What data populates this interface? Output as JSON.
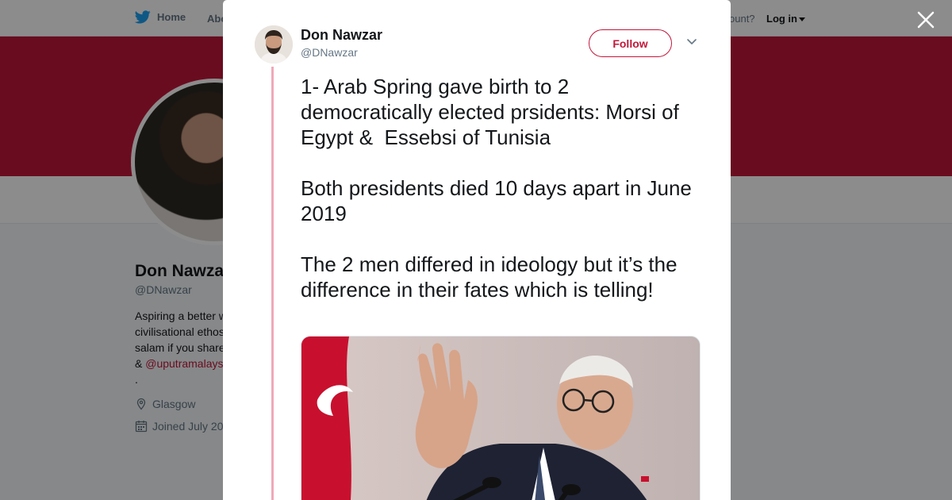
{
  "nav": {
    "home_label": "Home",
    "about_label": "Abo",
    "account_prompt": "ccount?",
    "login_label": "Log in"
  },
  "profile": {
    "name": "Don Nawza",
    "handle": "@DNawzar",
    "bio_lines": [
      "Aspiring a better w",
      "civilisational ethos",
      "salam if you share",
      "& ",
      "."
    ],
    "bio_mention": "@uputramalays",
    "location": "Glasgow",
    "joined": "Joined July 20"
  },
  "tweet": {
    "author_name": "Don Nawzar",
    "author_handle": "@DNawzar",
    "follow_label": "Follow",
    "text": "1- Arab Spring gave birth to 2 democratically elected prsidents: Morsi of Egypt &  Essebsi of Tunisia\n\nBoth presidents died 10 days apart in June 2019\n\nThe 2 men differed in ideology but it’s the difference in their fates which is telling!"
  },
  "colors": {
    "accent": "#c2173a",
    "thread_line": "#f0a9b8",
    "twitter_blue": "#1da1f2"
  },
  "icons": {
    "home": "twitter-bird-icon",
    "close": "close-icon",
    "chevron": "chevron-down-icon",
    "location": "location-pin-icon",
    "calendar": "calendar-icon"
  }
}
